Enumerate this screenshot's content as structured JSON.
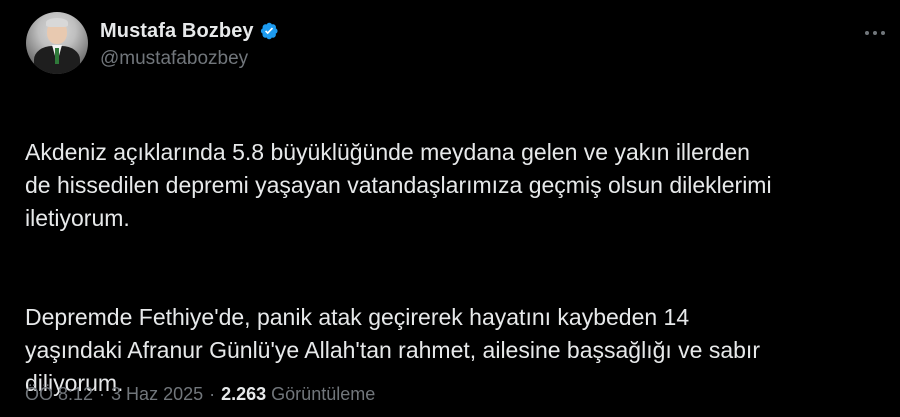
{
  "author": {
    "display_name": "Mustafa Bozbey",
    "handle": "@mustafabozbey",
    "verified": true,
    "avatar_icon": "profile-photo"
  },
  "tweet": {
    "paragraphs": [
      "Akdeniz açıklarında 5.8 büyüklüğünde meydana gelen ve yakın illerden\nde hissedilen depremi yaşayan vatandaşlarımıza geçmiş olsun dileklerimi\niletiyorum.",
      "Depremde Fethiye'de, panik atak geçirerek hayatını kaybeden 14\nyaşındaki Afranur Günlü'ye Allah'tan rahmet, ailesine başsağlığı ve sabır\ndiliyorum."
    ]
  },
  "meta": {
    "time": "ÖÖ 8:12",
    "separator": "·",
    "date": "3 Haz 2025",
    "views_count": "2.263",
    "views_label": "Görüntüleme"
  },
  "colors": {
    "background": "#000000",
    "text_primary": "#e7e9ea",
    "text_secondary": "#71767b",
    "verified_badge": "#1d9bf0"
  }
}
